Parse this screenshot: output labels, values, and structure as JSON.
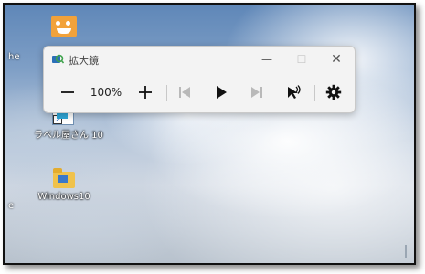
{
  "window": {
    "title": "拡大鏡",
    "minimize_symbol": "—",
    "maximize_symbol": "☐",
    "close_symbol": "✕"
  },
  "toolbar": {
    "zoom_out_icon": "minus-icon",
    "zoom_level": "100%",
    "zoom_in_icon": "plus-icon",
    "prev_icon": "skip-back-icon",
    "play_icon": "play-icon",
    "next_icon": "skip-forward-icon",
    "read_from_here_icon": "read-from-here-icon",
    "settings_icon": "gear-icon"
  },
  "desktop": {
    "edge_text_1": "he",
    "edge_text_2": "e",
    "icons": [
      {
        "label": "",
        "icon": "app-face-icon"
      },
      {
        "label": "ラベル屋さん 10",
        "icon": "label-app-icon"
      },
      {
        "label": "Windows10",
        "icon": "folder-icon"
      }
    ]
  },
  "colors": {
    "window_bg": "#f3f3f3",
    "desktop_sky": "#6f93c0",
    "folder": "#f0c24b"
  }
}
